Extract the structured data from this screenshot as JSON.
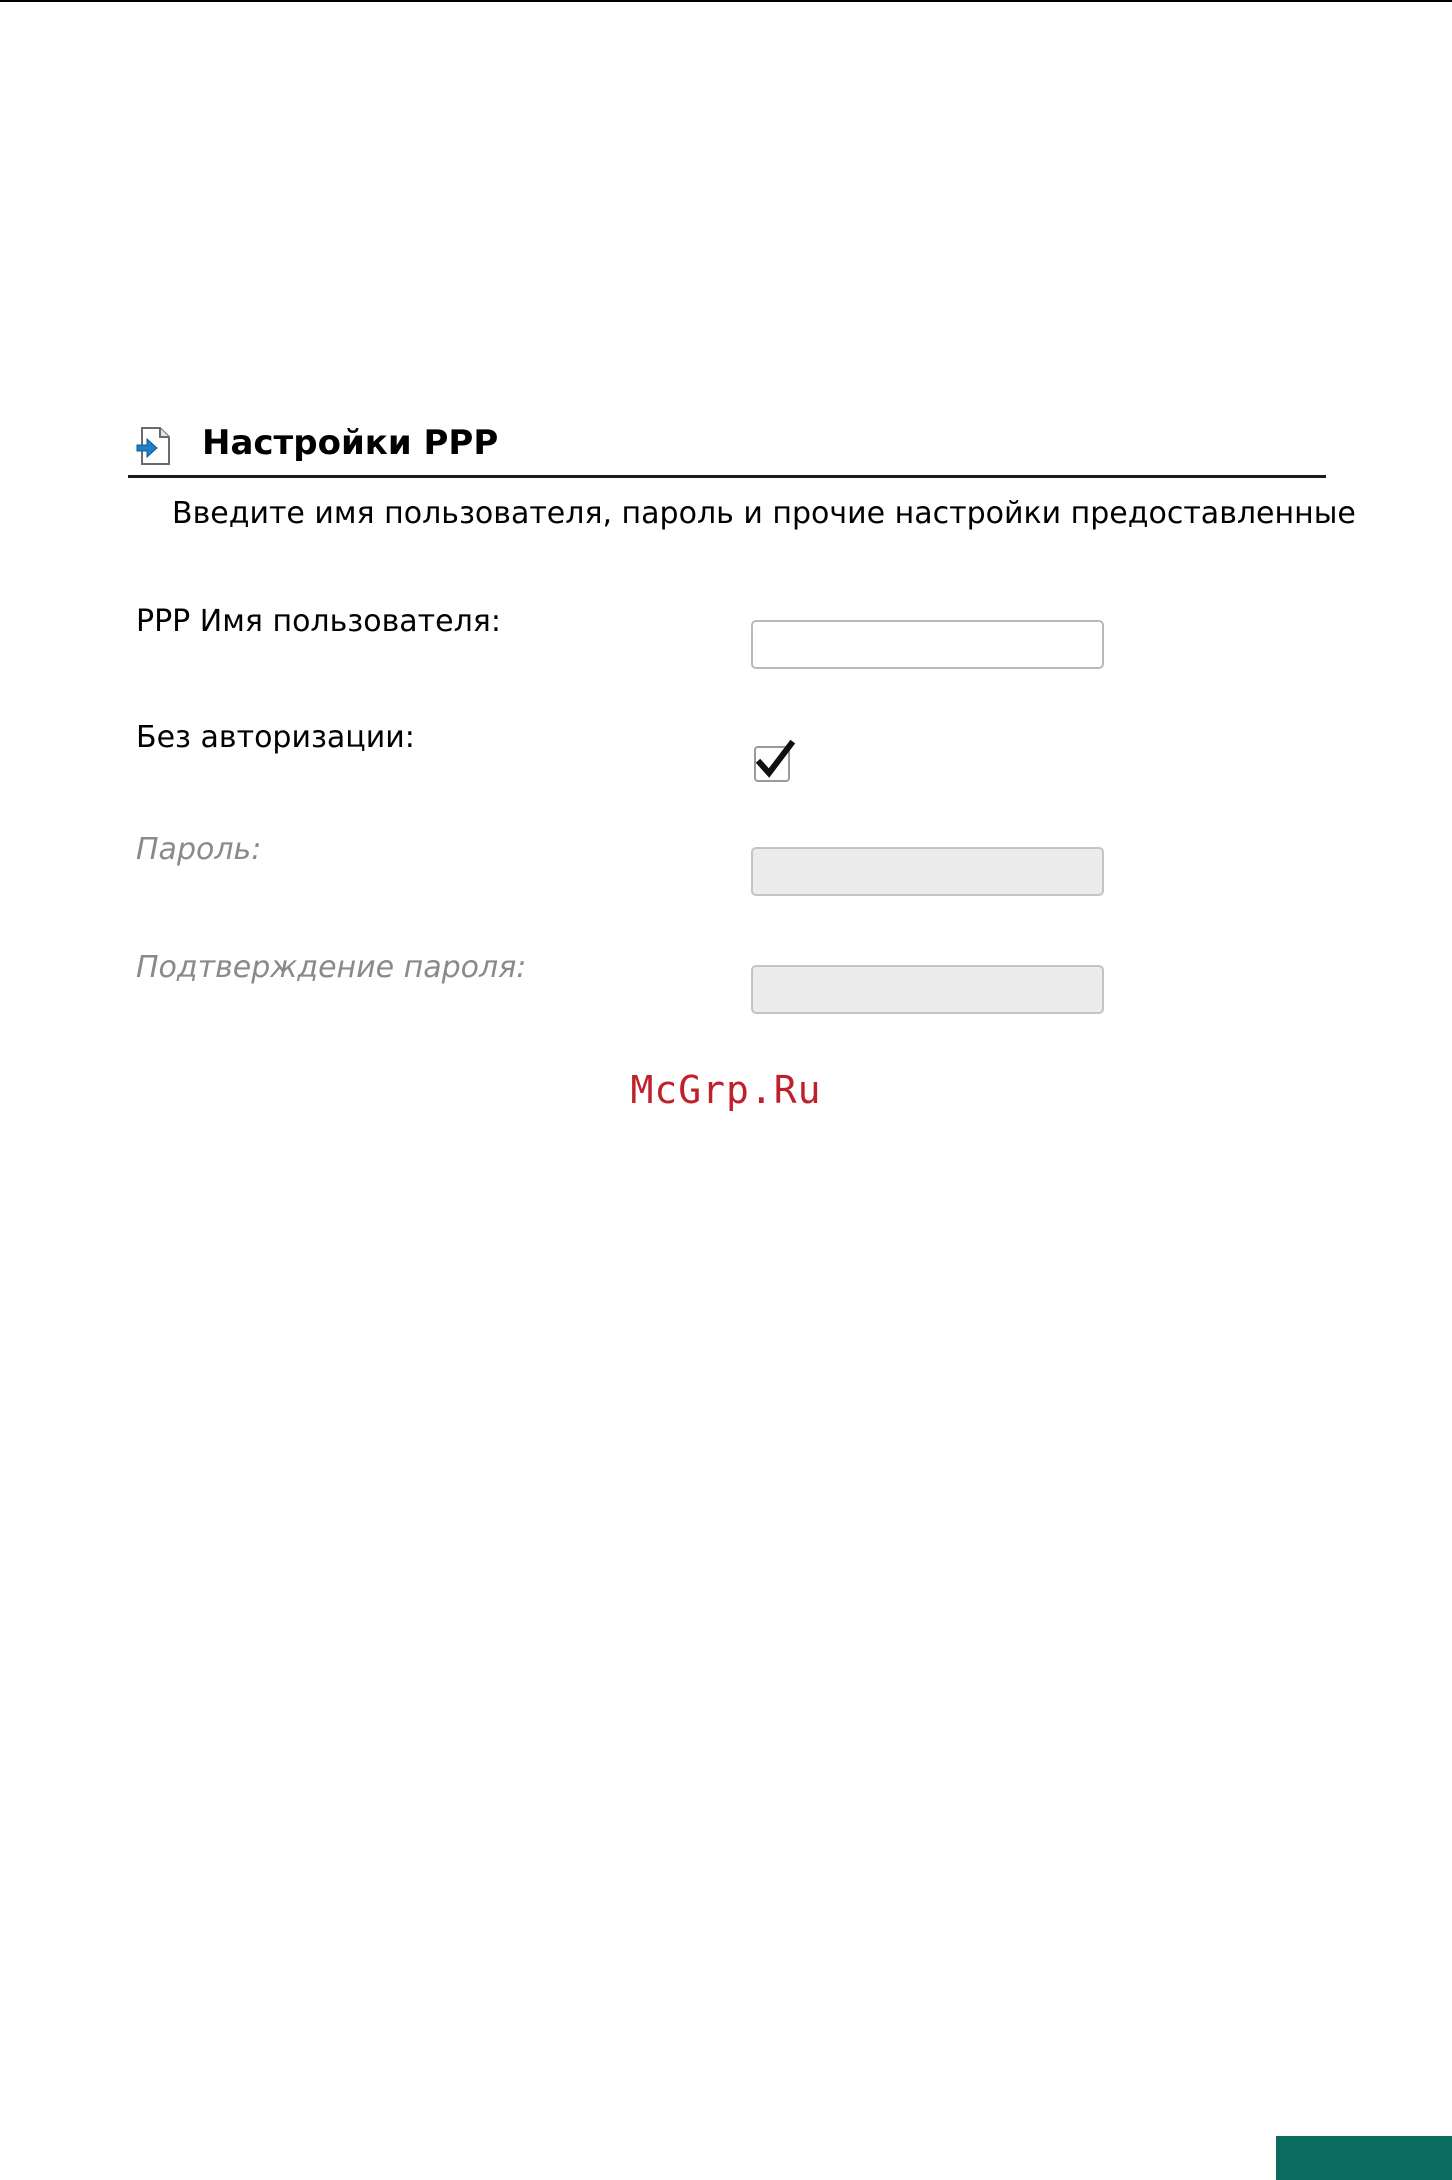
{
  "section": {
    "title": "Настройки PPP",
    "icon": "page-arrow-icon",
    "description": "Введите имя пользователя, пароль и прочие настройки предоставленные"
  },
  "fields": {
    "username": {
      "label": "PPP Имя пользователя:",
      "value": "",
      "enabled": true
    },
    "no_auth": {
      "label": "Без авторизации:",
      "checked": true
    },
    "password": {
      "label": "Пароль:",
      "value": "",
      "enabled": false
    },
    "password_confirm": {
      "label": "Подтверждение пароля:",
      "value": "",
      "enabled": false
    }
  },
  "watermark": "McGrp.Ru",
  "colors": {
    "watermark": "#c0202c",
    "page_tab": "#0a6b5f",
    "icon_arrow": "#1e7fc8",
    "disabled_label": "#8a8a8a"
  }
}
